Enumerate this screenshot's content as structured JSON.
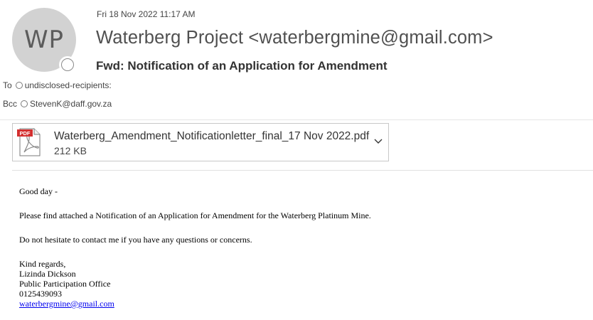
{
  "message": {
    "avatar_initials": "WP",
    "date": "Fri 18 Nov 2022 11:17 AM",
    "sender": "Waterberg Project <waterbergmine@gmail.com>",
    "subject": "Fwd: Notification of an Application for Amendment",
    "to_label": "To",
    "to_value": "undisclosed-recipients:",
    "bcc_label": "Bcc",
    "bcc_value": "StevenK@daff.gov.za"
  },
  "attachment": {
    "name": "Waterberg_Amendment_Notificationletter_final_17 Nov 2022.pdf",
    "size": "212 KB",
    "icon": "pdf-file-icon",
    "badge": "PDF"
  },
  "body": {
    "greeting": "Good day -",
    "paragraph1": "Please find attached a Notification of an Application for Amendment for the Waterberg Platinum Mine.",
    "paragraph2": "Do not hesitate to contact me if you have any questions or concerns.",
    "closing": "Kind regards,",
    "name": "Lizinda Dickson",
    "office": "Public Participation Office",
    "phone": "0125439093",
    "email_link": "waterbergmine@gmail.com"
  }
}
